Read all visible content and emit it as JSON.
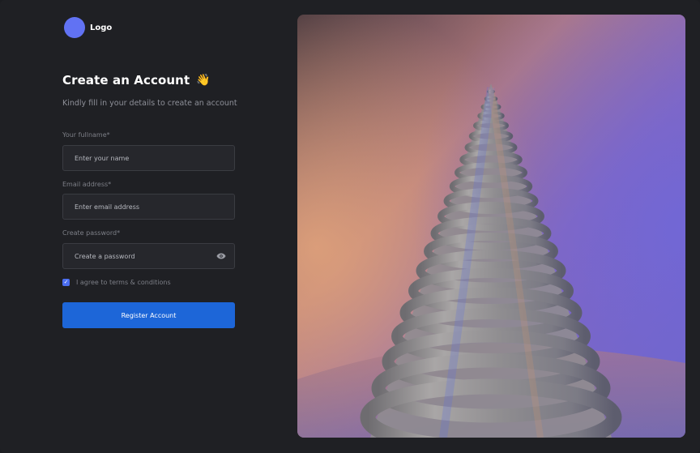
{
  "logo": {
    "text": "Logo",
    "color": "#6172f3"
  },
  "heading": {
    "title": "Create an Account",
    "emoji": "👋",
    "subtitle": "Kindly fill in your details to create an account"
  },
  "form": {
    "fullname": {
      "label": "Your fullname*",
      "placeholder": "Enter your name"
    },
    "email": {
      "label": "Email address*",
      "placeholder": "Enter email address"
    },
    "password": {
      "label": "Create password*",
      "placeholder": "Create a password",
      "icon": "eye-icon"
    },
    "terms": {
      "checked": true,
      "label": "I agree to terms & conditions"
    },
    "submit": {
      "label": "Register Account",
      "color": "#1d66d8"
    }
  },
  "hero": {
    "description_icon": "spiral-cone-image"
  }
}
